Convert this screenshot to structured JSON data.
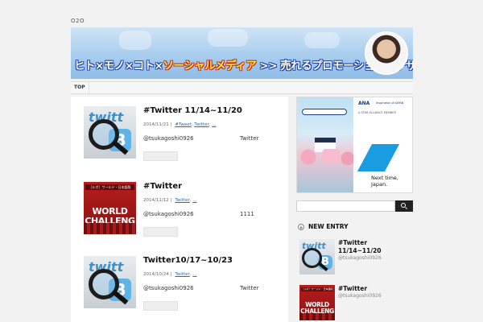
{
  "site": {
    "label": "O2O"
  },
  "banner": {
    "part_people": "ヒト×モノ×コト×",
    "part_social": "ソーシャルメディア",
    "part_tagline": " >> 売れるプロモーションをデザインする"
  },
  "nav": {
    "top": "TOP"
  },
  "entries": [
    {
      "title": "#Twitter 11/14~11/20",
      "date": "2014/11/21",
      "tags": [
        "#Tweet",
        "Twitter",
        "..."
      ],
      "author": "@tsukagoshi0926",
      "excerpt": "Twitter",
      "thumb": "twitter"
    },
    {
      "title": "#Twitter",
      "date": "2014/11/12",
      "tags": [
        "Twitter",
        "..."
      ],
      "author": "@tsukagoshi0926",
      "excerpt": "1111",
      "thumb": "world"
    },
    {
      "title": "Twitter10/17~10/23",
      "date": "2014/10/24",
      "tags": [
        "Twitter",
        "..."
      ],
      "author": "@tsukagoshi0926",
      "excerpt": "Twitter",
      "thumb": "twitter"
    }
  ],
  "thumbs": {
    "twitter_word": "twitt",
    "twitter_box": "B",
    "world_header": "［ルポ］ワールド・日本語版",
    "world_line1": "WORLD",
    "world_line2": "CHALLENG"
  },
  "ad": {
    "brand": "ANA",
    "tagline": "Inspiration of JAPAN",
    "alliance": "A STAR ALLIANCE MEMBER",
    "copy_line1": "Next time,",
    "copy_line2": "Japan."
  },
  "search": {
    "placeholder": ""
  },
  "sidebar": {
    "new_entry_title": "NEW ENTRY",
    "items": [
      {
        "title": "#Twitter 11/14~11/20",
        "author": "@tsukagoshi0926",
        "thumb": "twitter"
      },
      {
        "title": "#Twitter",
        "author": "@tsukagoshi0926",
        "thumb": "world"
      }
    ]
  },
  "colors": {
    "link": "#2a6db5",
    "banner_outline": "#1a3fa8",
    "search_button": "#222222",
    "ad_blue": "#1a9ce0"
  }
}
